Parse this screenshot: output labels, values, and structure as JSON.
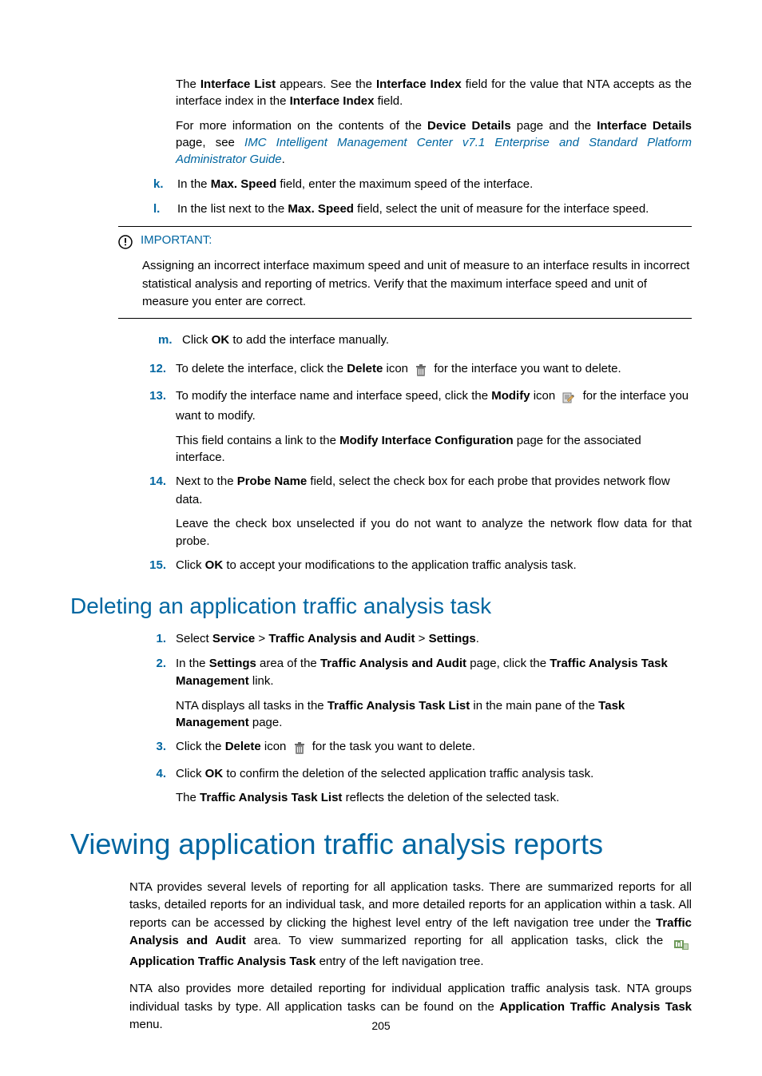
{
  "top": {
    "p1_a": "The ",
    "p1_b": "Interface List",
    "p1_c": " appears. See the ",
    "p1_d": "Interface Index",
    "p1_e": " field for the value that NTA accepts as the interface index in the ",
    "p1_f": "Interface Index",
    "p1_g": " field.",
    "p2_a": "For more information on the contents of the ",
    "p2_b": "Device Details",
    "p2_c": " page and the ",
    "p2_d": "Interface Details",
    "p2_e": " page, see ",
    "p2_link": "IMC Intelligent Management Center v7.1 Enterprise and Standard Platform Administrator Guide",
    "p2_f": "."
  },
  "alpha_kl": {
    "k_mark": "k.",
    "k_a": "In the ",
    "k_b": "Max. Speed",
    "k_c": " field, enter the maximum speed of the interface.",
    "l_mark": "l.",
    "l_a": "In the list next to the ",
    "l_b": "Max. Speed",
    "l_c": " field, select the unit of measure for the interface speed."
  },
  "important": {
    "title": "IMPORTANT:",
    "body": "Assigning an incorrect interface maximum speed and unit of measure to an interface results in incorrect statistical analysis and reporting of metrics. Verify that the maximum interface speed and unit of measure you enter are correct."
  },
  "alpha_m": {
    "mark": "m.",
    "a": "Click ",
    "b": "OK",
    "c": " to add the interface manually."
  },
  "steps12_15": {
    "s12_mark": "12.",
    "s12_a": "To delete the interface, click the ",
    "s12_b": "Delete",
    "s12_c": " icon ",
    "s12_d": " for the interface you want to delete.",
    "s13_mark": "13.",
    "s13_a": "To modify the interface name and interface speed, click the ",
    "s13_b": "Modify",
    "s13_c": " icon ",
    "s13_d": " for the interface you want to modify.",
    "s13_p2_a": "This field contains a link to the ",
    "s13_p2_b": "Modify Interface Configuration",
    "s13_p2_c": " page for the associated interface.",
    "s14_mark": "14.",
    "s14_a": "Next to the ",
    "s14_b": "Probe Name",
    "s14_c": " field, select the check box for each probe that provides network flow data.",
    "s14_p2": "Leave the check box unselected if you do not want to analyze the network flow data for that probe.",
    "s15_mark": "15.",
    "s15_a": "Click ",
    "s15_b": "OK",
    "s15_c": " to accept your modifications to the application traffic analysis task."
  },
  "h2_deleting": "Deleting an application traffic analysis task",
  "del_steps": {
    "s1_mark": "1.",
    "s1_a": "Select ",
    "s1_b": "Service",
    "s1_c": " > ",
    "s1_d": "Traffic Analysis and Audit",
    "s1_e": " > ",
    "s1_f": "Settings",
    "s1_g": ".",
    "s2_mark": "2.",
    "s2_a": "In the ",
    "s2_b": "Settings",
    "s2_c": " area of the ",
    "s2_d": "Traffic Analysis and Audit",
    "s2_e": " page, click the ",
    "s2_f": "Traffic Analysis Task Management",
    "s2_g": " link.",
    "s2_p2_a": "NTA displays all tasks in the ",
    "s2_p2_b": "Traffic Analysis Task List",
    "s2_p2_c": " in the main pane of the ",
    "s2_p2_d": "Task Management",
    "s2_p2_e": " page.",
    "s3_mark": "3.",
    "s3_a": "Click the ",
    "s3_b": "Delete",
    "s3_c": " icon ",
    "s3_d": " for the task you want to delete.",
    "s4_mark": "4.",
    "s4_a": "Click ",
    "s4_b": "OK",
    "s4_c": " to confirm the deletion of the selected application traffic analysis task.",
    "s4_p2_a": "The ",
    "s4_p2_b": "Traffic Analysis Task List",
    "s4_p2_c": " reflects the deletion of the selected task."
  },
  "h1_viewing": "Viewing application traffic analysis reports",
  "view": {
    "p1_a": "NTA provides several levels of reporting for all application tasks. There are summarized reports for all tasks, detailed reports for an individual task, and more detailed reports for an application within a task. All reports can be accessed by clicking the highest level entry of the left navigation tree under the ",
    "p1_b": "Traffic Analysis and Audit",
    "p1_c": " area. To view summarized reporting for all application tasks, click the ",
    "p1_d": "Application Traffic Analysis Task",
    "p1_e": " entry of the left navigation tree.",
    "p2_a": "NTA also provides more detailed reporting for individual application traffic analysis task. NTA groups individual tasks by type. All application tasks can be found on the ",
    "p2_b": "Application Traffic Analysis Task",
    "p2_c": " menu."
  },
  "page_number": "205"
}
